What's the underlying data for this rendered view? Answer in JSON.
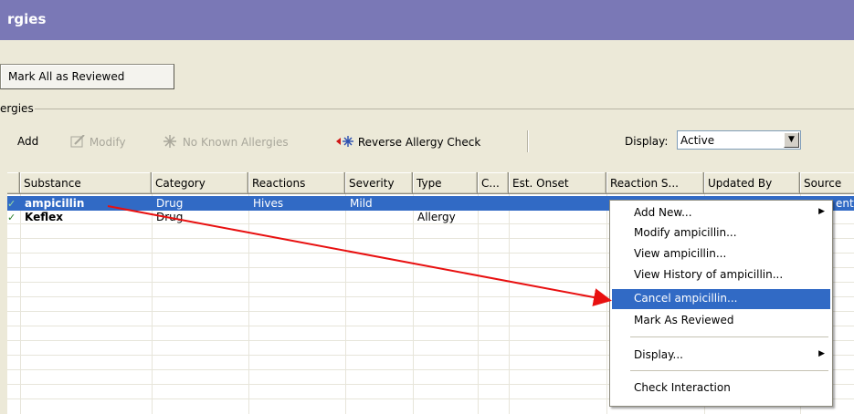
{
  "window": {
    "title": "rgies"
  },
  "actions": {
    "mark_all_label": "Mark All as Reviewed"
  },
  "group": {
    "label": "ergies"
  },
  "toolbar": {
    "add_label": "Add",
    "modify_label": "Modify",
    "no_known_label": "No Known Allergies",
    "reverse_check_label": "Reverse Allergy Check",
    "display_label": "Display:",
    "display_value": "Active"
  },
  "grid": {
    "columns": [
      "",
      "Substance",
      "Category",
      "Reactions",
      "Severity",
      "Type",
      "C...",
      "Est. Onset",
      "Reaction S...",
      "Updated By",
      "Source"
    ],
    "rows": [
      {
        "substance": "ampicillin",
        "category": "Drug",
        "reactions": "Hives",
        "severity": "Mild",
        "type": "",
        "source": "ent"
      },
      {
        "substance": "Keflex",
        "category": "Drug",
        "reactions": "",
        "severity": "",
        "type": "Allergy",
        "source": ""
      }
    ]
  },
  "context_menu": {
    "items": [
      {
        "label": "Add New...",
        "submenu": true
      },
      {
        "label": "Modify ampicillin..."
      },
      {
        "label": "View ampicillin..."
      },
      {
        "label": "View History of ampicillin..."
      },
      {
        "label": "Cancel ampicillin...",
        "highlighted": true
      },
      {
        "label": "Mark As Reviewed"
      },
      {
        "label": "Display...",
        "submenu": true
      },
      {
        "label": "Check Interaction"
      }
    ]
  },
  "colors": {
    "title_bar": "#7a78b6",
    "selection": "#316ac5",
    "annotation_arrow": "#e81010",
    "dialog_bg": "#ece9d8"
  },
  "icons": [
    "modify-icon",
    "no-known-allergies-icon",
    "reverse-check-icon",
    "checkmark-icon",
    "dropdown-arrow-icon",
    "submenu-arrow-icon"
  ]
}
